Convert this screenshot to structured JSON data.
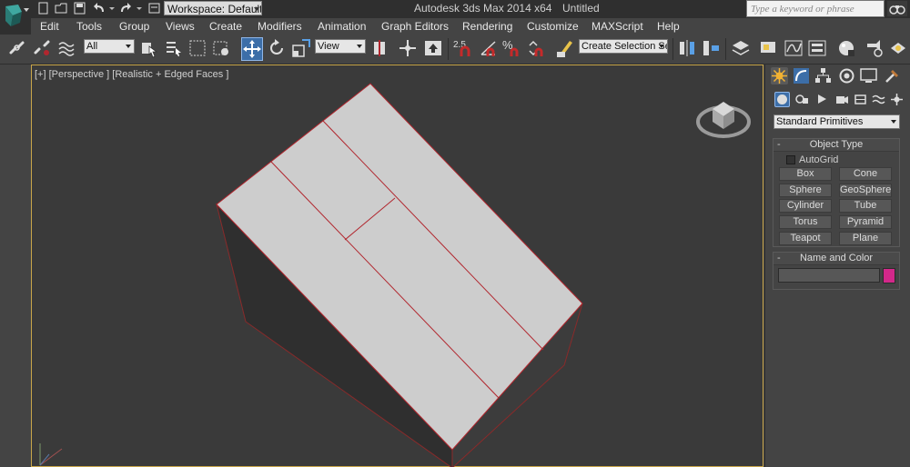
{
  "titlebar": {
    "workspace_label": "Workspace: Default",
    "app_title": "Autodesk 3ds Max  2014 x64",
    "document_title": "Untitled",
    "search_placeholder": "Type a keyword or phrase"
  },
  "menu": {
    "items": [
      "Edit",
      "Tools",
      "Group",
      "Views",
      "Create",
      "Modifiers",
      "Animation",
      "Graph Editors",
      "Rendering",
      "Customize",
      "MAXScript",
      "Help"
    ]
  },
  "toolbar": {
    "selection_filter": "All",
    "reference_coord": "View",
    "named_selection_set": "Create Selection Se",
    "snap_angle_label": "2.5",
    "percent_snap_label": "%"
  },
  "viewport": {
    "label": "[+] [Perspective ] [Realistic + Edged Faces ]"
  },
  "command_panel": {
    "primitive_type": "Standard Primitives",
    "object_type_title": "Object Type",
    "autogrid_label": "AutoGrid",
    "buttons": [
      "Box",
      "Cone",
      "Sphere",
      "GeoSphere",
      "Cylinder",
      "Tube",
      "Torus",
      "Pyramid",
      "Teapot",
      "Plane"
    ],
    "name_color_title": "Name and Color",
    "object_color": "#d3288a"
  },
  "colors": {
    "viewport_border": "#c9a64a",
    "active_button": "#3c6ea8",
    "edge_highlight": "#b1262e"
  }
}
